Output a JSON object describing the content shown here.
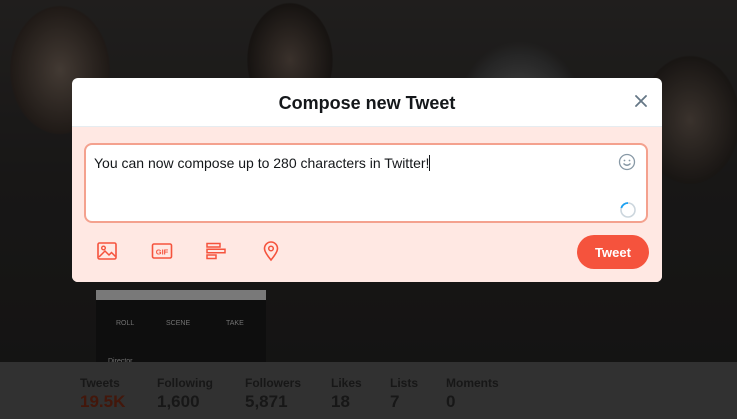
{
  "modal": {
    "title": "Compose new Tweet",
    "tweet_text": "You can now compose up to 280 characters in Twitter!",
    "tweet_button": "Tweet",
    "toolbar": {
      "gif_label": "GIF"
    },
    "icons": {
      "close": "close-icon",
      "emoji": "emoji-icon",
      "media": "image-icon",
      "gif": "gif-icon",
      "poll": "poll-icon",
      "location": "location-icon",
      "counter": "character-counter-ring"
    },
    "colors": {
      "accent": "#f5533d",
      "body_bg": "#ffe8e3",
      "border": "#f4a18e"
    }
  },
  "stats": [
    {
      "label": "Tweets",
      "value": "19.5K"
    },
    {
      "label": "Following",
      "value": "1,600"
    },
    {
      "label": "Followers",
      "value": "5,871"
    },
    {
      "label": "Likes",
      "value": "18"
    },
    {
      "label": "Lists",
      "value": "7"
    },
    {
      "label": "Moments",
      "value": "0"
    }
  ],
  "background": {
    "clapper": [
      "ROLL",
      "SCENE",
      "TAKE",
      "Director"
    ]
  }
}
